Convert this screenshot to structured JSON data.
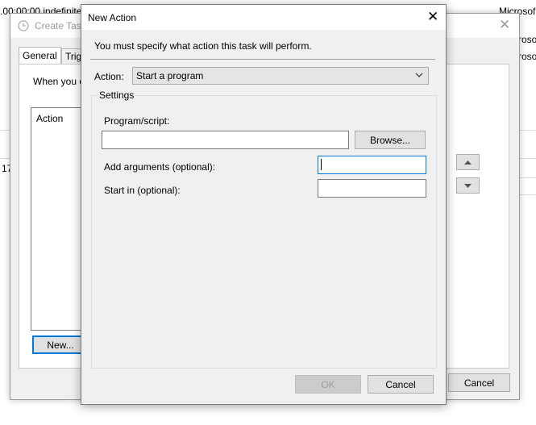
{
  "background": {
    "row1_text": ".00:00:00 indefinitel",
    "row3_prefix": "17",
    "right_column": [
      "Microsof",
      "rosof",
      "rosof"
    ]
  },
  "create_task": {
    "title": "Create Task",
    "tabs": [
      "General",
      "Trig"
    ],
    "intro_text": "When you c",
    "list_header": "Action",
    "new_button": "New...",
    "cancel_button": "Cancel",
    "move_up_icon": "triangle-up-icon",
    "move_down_icon": "triangle-down-icon"
  },
  "new_action": {
    "title": "New Action",
    "instruction": "You must specify what action this task will perform.",
    "action_label": "Action:",
    "action_value": "Start a program",
    "settings_label": "Settings",
    "program_label": "Program/script:",
    "program_value": "",
    "browse_button": "Browse...",
    "arguments_label": "Add arguments (optional):",
    "arguments_value": "",
    "start_in_label": "Start in (optional):",
    "start_in_value": "",
    "ok_button": "OK",
    "cancel_button": "Cancel"
  },
  "colors": {
    "focus_accent": "#0078d7",
    "dialog_bg": "#f0f0f0"
  }
}
